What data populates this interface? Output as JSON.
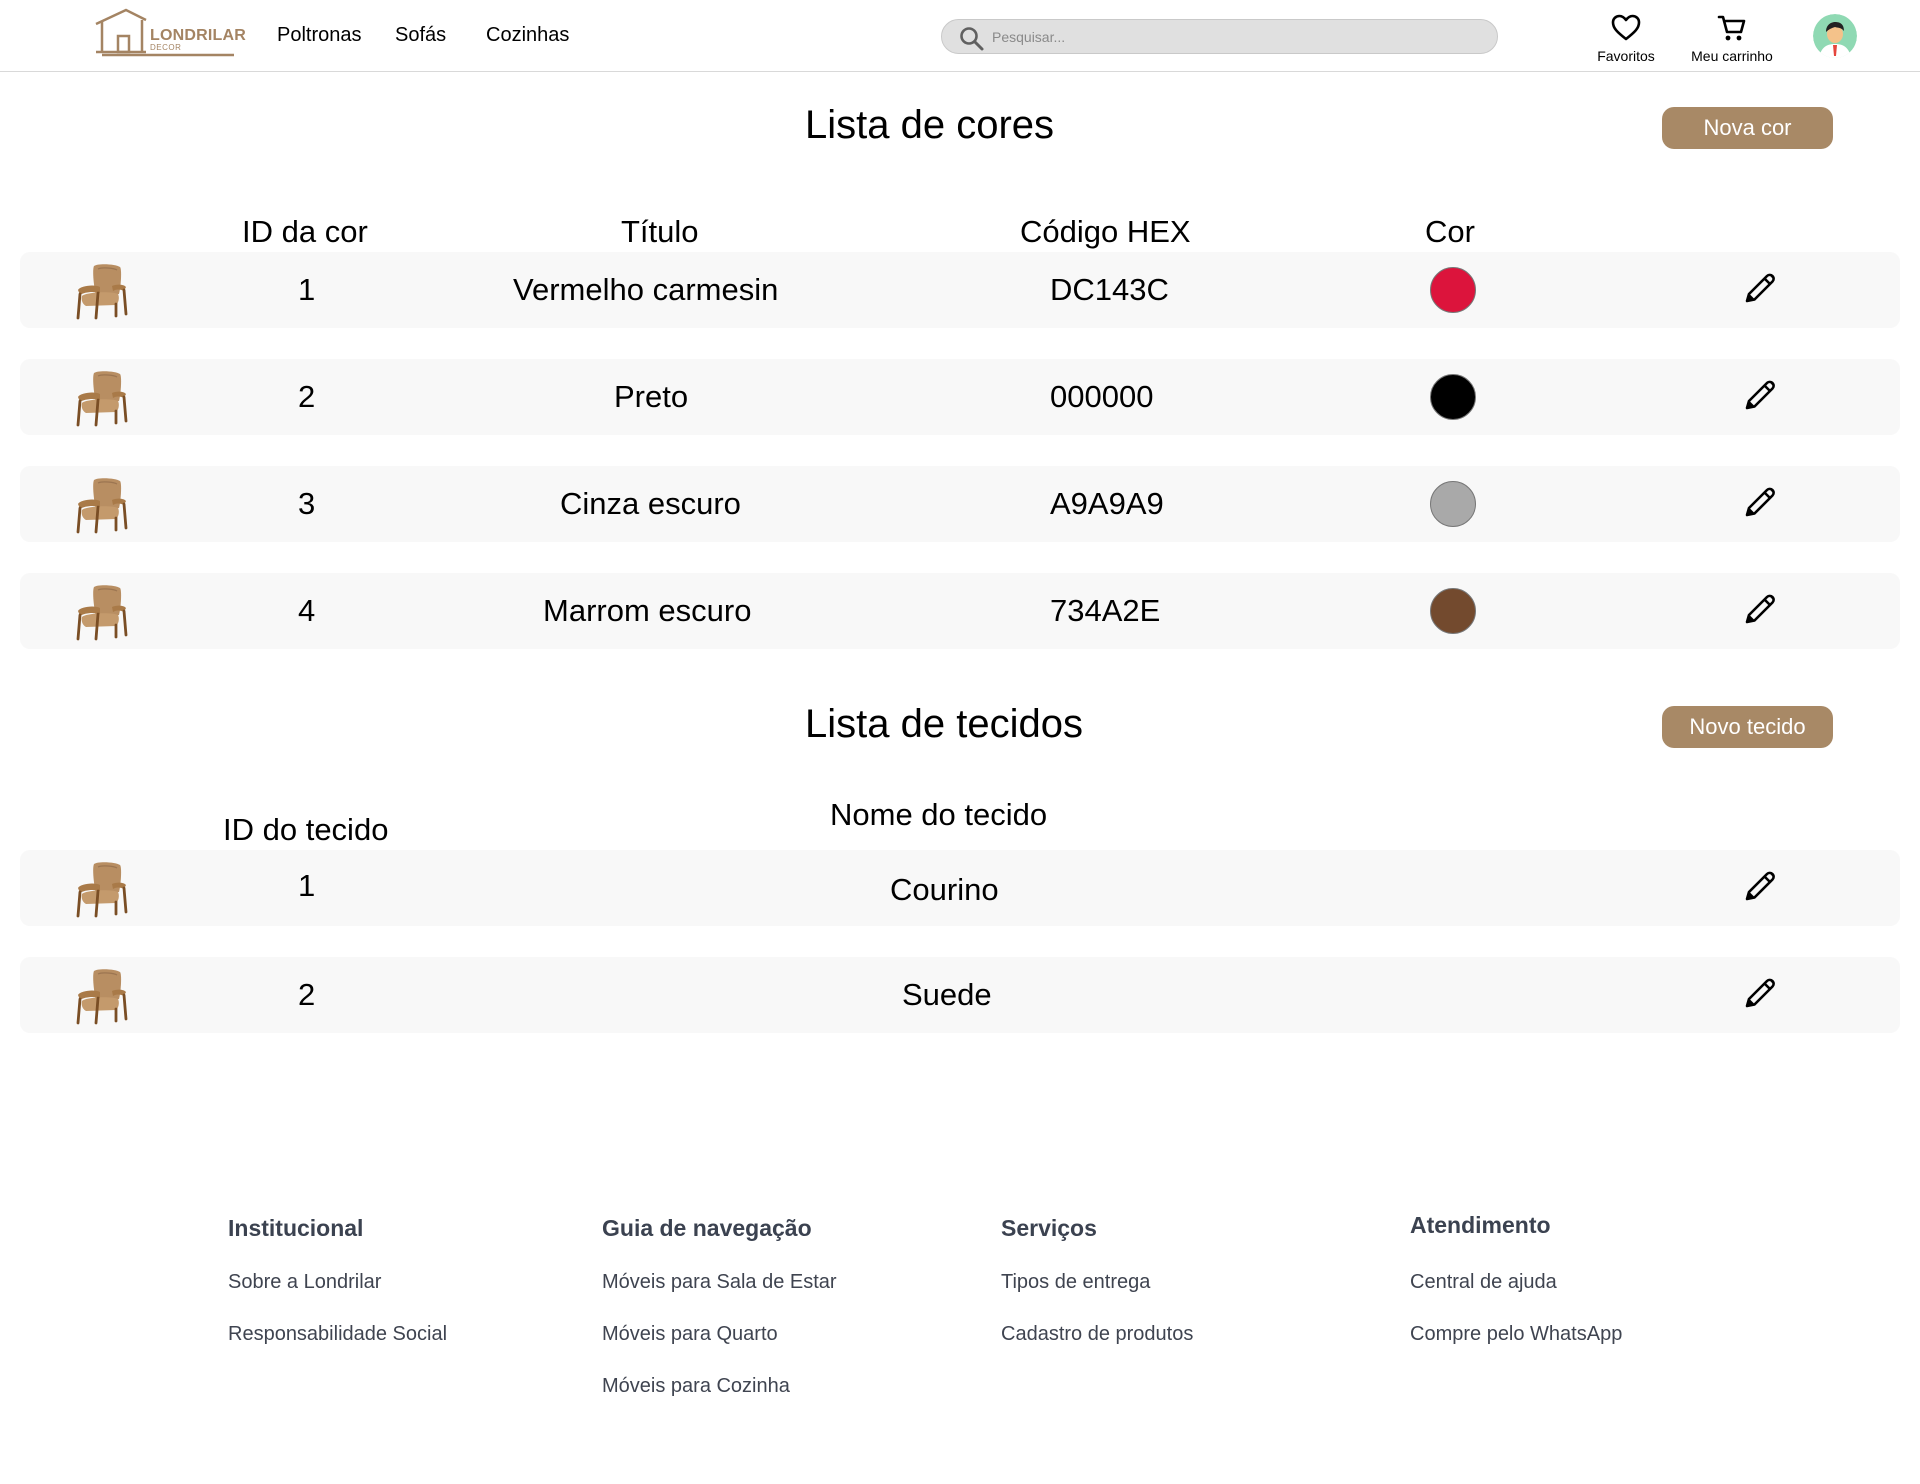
{
  "header": {
    "logo_text": "LONDRILAR",
    "logo_sub": "DECOR",
    "nav": [
      "Poltronas",
      "Sofás",
      "Cozinhas"
    ],
    "search_placeholder": "Pesquisar...",
    "favorites_label": "Favoritos",
    "cart_label": "Meu carrinho"
  },
  "colors_section": {
    "title": "Lista de cores",
    "new_button": "Nova cor",
    "columns": [
      "ID da cor",
      "Título",
      "Código HEX",
      "Cor"
    ],
    "rows": [
      {
        "id": "1",
        "title": "Vermelho carmesin",
        "hex": "DC143C",
        "swatch": "#DC143C"
      },
      {
        "id": "2",
        "title": "Preto",
        "hex": "000000",
        "swatch": "#000000"
      },
      {
        "id": "3",
        "title": "Cinza escuro",
        "hex": "A9A9A9",
        "swatch": "#A9A9A9"
      },
      {
        "id": "4",
        "title": "Marrom escuro",
        "hex": "734A2E",
        "swatch": "#734A2E"
      }
    ]
  },
  "fabrics_section": {
    "title": "Lista de tecidos",
    "new_button": "Novo tecido",
    "columns": [
      "ID do tecido",
      "Nome do tecido"
    ],
    "rows": [
      {
        "id": "1",
        "name": "Courino"
      },
      {
        "id": "2",
        "name": "Suede"
      }
    ]
  },
  "footer": {
    "columns": [
      {
        "title": "Institucional",
        "links": [
          "Sobre a Londrilar",
          "Responsabilidade Social"
        ]
      },
      {
        "title": "Guia de navegação",
        "links": [
          "Móveis para Sala de Estar",
          "Móveis para Quarto",
          "Móveis para Cozinha"
        ]
      },
      {
        "title": "Serviços",
        "links": [
          "Tipos de entrega",
          "Cadastro de produtos"
        ]
      },
      {
        "title": "Atendimento",
        "links": [
          "Central de ajuda",
          "Compre pelo WhatsApp"
        ]
      }
    ]
  },
  "theme": {
    "accent": "#a88966",
    "row_bg": "#f8f8f8"
  },
  "icons": [
    "logo-house-icon",
    "search-icon",
    "heart-icon",
    "cart-icon",
    "avatar",
    "armchair-icon",
    "pencil-icon"
  ]
}
